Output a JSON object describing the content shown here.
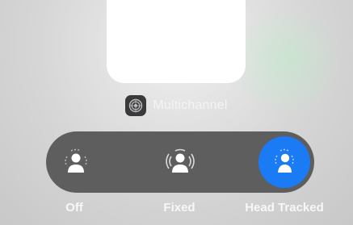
{
  "source": {
    "label": "Multichannel",
    "icon": "speaker-grille-icon"
  },
  "spatial_audio_modes": [
    {
      "label": "Off",
      "icon": "person-waves-icon",
      "selected": false
    },
    {
      "label": "Fixed",
      "icon": "person-waves-icon",
      "selected": false
    },
    {
      "label": "Head Tracked",
      "icon": "person-waves-icon",
      "selected": true
    }
  ],
  "colors": {
    "selected": "#1b7bf5",
    "pill": "#5e5e5f",
    "label": "#f7f7f7"
  }
}
